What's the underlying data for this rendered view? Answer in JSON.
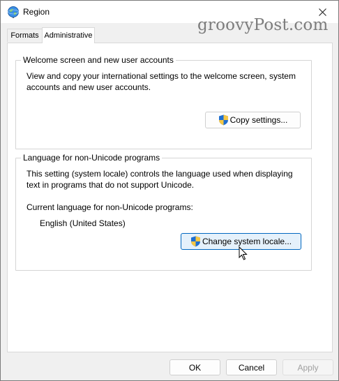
{
  "window": {
    "title": "Region",
    "icon": "globe-icon",
    "close_icon": "close-icon"
  },
  "watermark": "groovyPost.com",
  "tabs": [
    {
      "label": "Formats",
      "selected": false
    },
    {
      "label": "Administrative",
      "selected": true
    }
  ],
  "welcome_group": {
    "title": "Welcome screen and new user accounts",
    "description_line1": "View and copy your international settings to the welcome screen, system",
    "description_line2": "accounts and new user accounts.",
    "copy_button": "Copy settings..."
  },
  "unicode_group": {
    "title": "Language for non-Unicode programs",
    "description_line1": "This setting (system locale) controls the language used when displaying",
    "description_line2": "text in programs that do not support Unicode.",
    "current_label": "Current language for non-Unicode programs:",
    "current_value": "English (United States)",
    "change_button": "Change system locale..."
  },
  "footer": {
    "ok": "OK",
    "cancel": "Cancel",
    "apply": "Apply"
  },
  "colors": {
    "accent": "#0067c0",
    "focused_button_bg": "#e5f1fb",
    "dialog_bg": "#f0f0f0"
  }
}
